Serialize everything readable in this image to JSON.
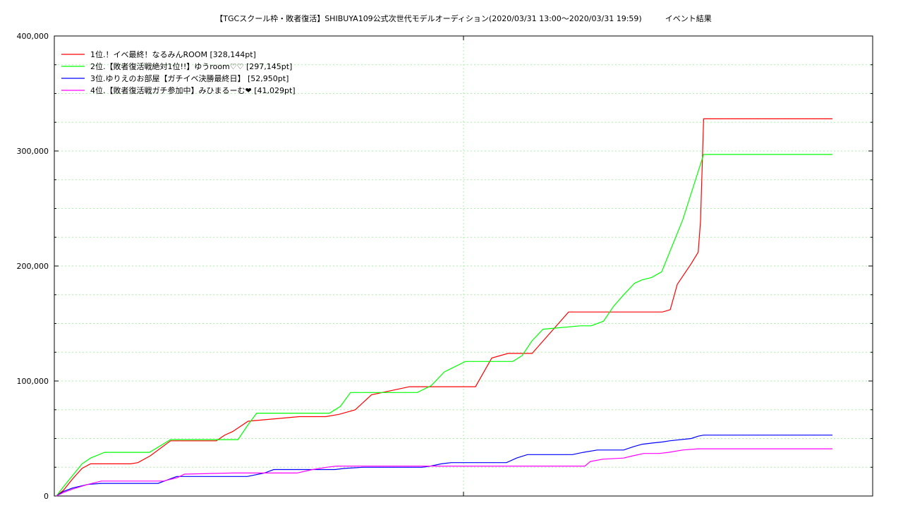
{
  "chart_data": {
    "type": "line",
    "title": "【TGCスクール枠・敗者復活】SHIBUYA109公式次世代モデルオーディション(2020/03/31 13:00〜2020/03/31 19:59)　　　イベント結果",
    "xlabel": "",
    "ylabel": "",
    "ylim": [
      0,
      400000
    ],
    "y_ticks": [
      0,
      100000,
      200000,
      300000,
      400000
    ],
    "y_tick_labels": [
      "0",
      "100,000",
      "200,000",
      "300,000",
      "400,000"
    ],
    "xlim": [
      0,
      1
    ],
    "grid": true,
    "legend_position": "top-left",
    "series": [
      {
        "name": "1位.！イベ最終！なるみんROOM [328,144pt]",
        "color": "#ff0000",
        "x": [
          0.0,
          0.009,
          0.021,
          0.033,
          0.044,
          0.096,
          0.105,
          0.121,
          0.147,
          0.206,
          0.217,
          0.227,
          0.247,
          0.313,
          0.324,
          0.334,
          0.347,
          0.364,
          0.385,
          0.406,
          0.455,
          0.476,
          0.497,
          0.54,
          0.561,
          0.582,
          0.613,
          0.626,
          0.66,
          0.731,
          0.781,
          0.791,
          0.8,
          0.818,
          0.827,
          0.83,
          0.834,
          1.0
        ],
        "y": [
          0,
          5000,
          15000,
          24000,
          28000,
          28000,
          29000,
          35000,
          48000,
          48000,
          53000,
          56000,
          65000,
          69000,
          69000,
          69000,
          69000,
          71000,
          75000,
          88000,
          95000,
          95000,
          95000,
          95000,
          120000,
          124000,
          124000,
          134000,
          160000,
          160000,
          160000,
          162000,
          184000,
          202000,
          212000,
          239000,
          328000,
          328000
        ]
      },
      {
        "name": "2位.【敗者復活戦絶対1位!!】ゆうroom♡♡ [297,145pt]",
        "color": "#00ff00",
        "x": [
          0.0,
          0.009,
          0.021,
          0.033,
          0.044,
          0.062,
          0.12,
          0.147,
          0.234,
          0.247,
          0.258,
          0.352,
          0.366,
          0.379,
          0.406,
          0.465,
          0.483,
          0.5,
          0.527,
          0.588,
          0.6,
          0.613,
          0.627,
          0.675,
          0.689,
          0.705,
          0.718,
          0.731,
          0.745,
          0.755,
          0.767,
          0.78,
          0.795,
          0.807,
          0.834,
          1.0
        ],
        "y": [
          0,
          8000,
          18000,
          28000,
          33000,
          38000,
          38000,
          49000,
          49000,
          62000,
          72000,
          72000,
          78000,
          90000,
          90000,
          90000,
          96000,
          108000,
          117000,
          117000,
          122000,
          135000,
          145000,
          148000,
          148000,
          152000,
          165000,
          175000,
          185000,
          188000,
          190000,
          195000,
          220000,
          240000,
          297000,
          297000
        ]
      },
      {
        "name": "3位.ゆりえのお部屋【ガチイベ決勝最終日】 [52,950pt]",
        "color": "#0000ff",
        "x": [
          0.0,
          0.009,
          0.021,
          0.04,
          0.058,
          0.131,
          0.155,
          0.246,
          0.268,
          0.28,
          0.359,
          0.371,
          0.395,
          0.471,
          0.482,
          0.496,
          0.509,
          0.58,
          0.593,
          0.607,
          0.617,
          0.665,
          0.679,
          0.697,
          0.731,
          0.744,
          0.755,
          0.767,
          0.781,
          0.79,
          0.818,
          0.827,
          0.834,
          1.0
        ],
        "y": [
          0,
          4000,
          7000,
          10000,
          11000,
          11000,
          17000,
          17000,
          20000,
          23000,
          23000,
          24000,
          25000,
          25000,
          26000,
          28000,
          29000,
          29000,
          33000,
          36000,
          36000,
          36000,
          38000,
          40000,
          40000,
          43000,
          45000,
          46000,
          47000,
          48000,
          50000,
          52000,
          52950,
          52950
        ]
      },
      {
        "name": "4位.【敗者復活戦ガチ参加中】みひまるーむ❤ [41,029pt]",
        "color": "#ff00ff",
        "x": [
          0.0,
          0.009,
          0.021,
          0.04,
          0.058,
          0.138,
          0.156,
          0.165,
          0.228,
          0.296,
          0.31,
          0.33,
          0.348,
          0.361,
          0.378,
          0.5,
          0.607,
          0.625,
          0.681,
          0.688,
          0.704,
          0.731,
          0.743,
          0.757,
          0.777,
          0.789,
          0.807,
          0.827,
          1.0
        ],
        "y": [
          0,
          3000,
          6000,
          10000,
          13000,
          13000,
          16000,
          19000,
          20000,
          20000,
          20000,
          23000,
          25000,
          26000,
          26000,
          26000,
          26000,
          26000,
          26000,
          30000,
          32000,
          33000,
          35000,
          37000,
          37000,
          38000,
          40000,
          41029,
          41029
        ]
      }
    ]
  }
}
